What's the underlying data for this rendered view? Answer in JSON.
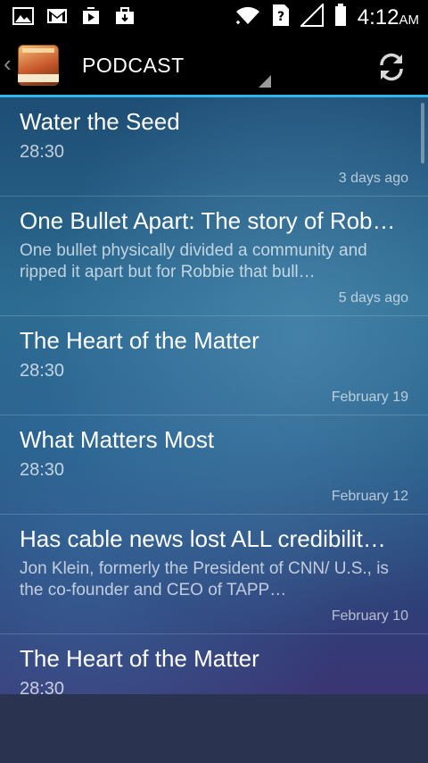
{
  "status_bar": {
    "icons": [
      "image-icon",
      "gmail-icon",
      "play-store-icon",
      "briefcase-icon",
      "wifi-icon",
      "no-sim-icon",
      "signal-icon",
      "battery-icon"
    ],
    "time": "4:12",
    "ampm": "AM"
  },
  "action_bar": {
    "title": "PODCAST"
  },
  "items": [
    {
      "title": "Water the Seed",
      "subtitle": "28:30",
      "date": "3 days ago"
    },
    {
      "title": "One Bullet Apart: The story of Rob…",
      "description": "One bullet physically divided a community and ripped it apart but for Robbie that bull…",
      "date": "5 days ago"
    },
    {
      "title": "The Heart of the Matter",
      "subtitle": "28:30",
      "date": "February 19"
    },
    {
      "title": "What Matters Most",
      "subtitle": "28:30",
      "date": "February 12"
    },
    {
      "title": "Has cable news lost ALL credibilit…",
      "description": "Jon Klein, formerly the President of CNN/ U.S.,  is the co-founder and CEO of TAPP…",
      "date": "February 10"
    },
    {
      "title": "The Heart of the Matter",
      "subtitle": "28:30",
      "date": ""
    }
  ]
}
